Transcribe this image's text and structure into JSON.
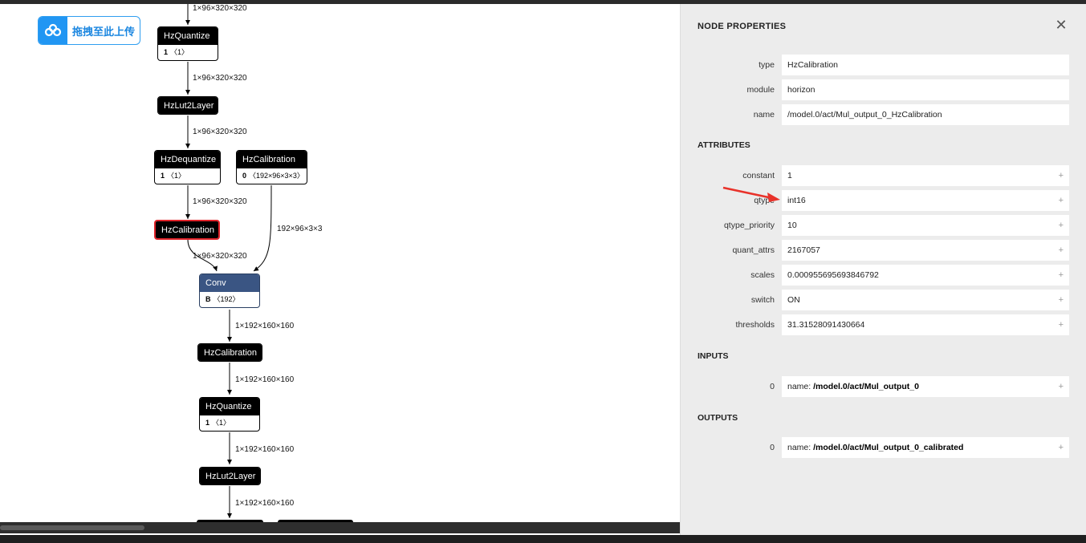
{
  "upload": {
    "label": "拖拽至此上传"
  },
  "graph": {
    "nodes": [
      {
        "id": "hzq1",
        "title": "HzQuantize",
        "attr_key": "1",
        "attr_val": "〈1〉"
      },
      {
        "id": "lut1",
        "title": "HzLut2Layer"
      },
      {
        "id": "deq",
        "title": "HzDequantize",
        "attr_key": "1",
        "attr_val": "〈1〉"
      },
      {
        "id": "cal_w",
        "title": "HzCalibration",
        "attr_key": "0",
        "attr_val": "〈192×96×3×3〉"
      },
      {
        "id": "cal_sel",
        "title": "HzCalibration"
      },
      {
        "id": "conv",
        "title": "Conv",
        "attr_key": "B",
        "attr_val": "〈192〉"
      },
      {
        "id": "cal2",
        "title": "HzCalibration"
      },
      {
        "id": "hzq2",
        "title": "HzQuantize",
        "attr_key": "1",
        "attr_val": "〈1〉"
      },
      {
        "id": "lut2",
        "title": "HzLut2Layer"
      }
    ],
    "edge_labels": [
      "1×96×320×320",
      "1×96×320×320",
      "1×96×320×320",
      "1×96×320×320",
      "192×96×3×3",
      "1×96×320×320",
      "1×192×160×160",
      "1×192×160×160",
      "1×192×160×160",
      "1×192×160×160"
    ]
  },
  "sidebar": {
    "title": "NODE PROPERTIES",
    "close_icon": "close-icon",
    "properties": [
      {
        "key": "type",
        "value": "HzCalibration"
      },
      {
        "key": "module",
        "value": "horizon"
      },
      {
        "key": "name",
        "value": "/model.0/act/Mul_output_0_HzCalibration"
      }
    ],
    "attributes_title": "ATTRIBUTES",
    "attributes": [
      {
        "key": "constant",
        "value": "1"
      },
      {
        "key": "qtype",
        "value": "int16"
      },
      {
        "key": "qtype_priority",
        "value": "10"
      },
      {
        "key": "quant_attrs",
        "value": "2167057"
      },
      {
        "key": "scales",
        "value": "0.000955695693846792"
      },
      {
        "key": "switch",
        "value": "ON"
      },
      {
        "key": "thresholds",
        "value": "31.31528091430664"
      }
    ],
    "inputs_title": "INPUTS",
    "inputs": [
      {
        "key": "0",
        "prefix": "name: ",
        "value": "/model.0/act/Mul_output_0"
      }
    ],
    "outputs_title": "OUTPUTS",
    "outputs": [
      {
        "key": "0",
        "prefix": "name: ",
        "value": "/model.0/act/Mul_output_0_calibrated"
      }
    ],
    "plus": "+"
  },
  "colors": {
    "selected_border": "#e0242a",
    "conv_header": "#3a5583",
    "arrow": "#e8322a"
  }
}
